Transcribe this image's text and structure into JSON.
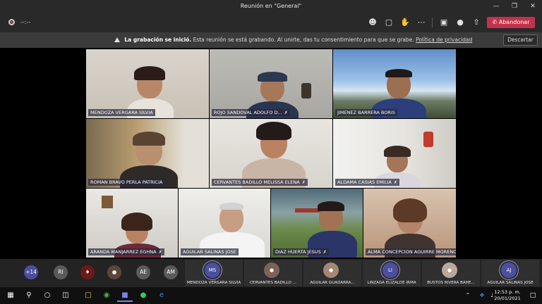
{
  "window": {
    "title": "Reunión en \"General\""
  },
  "toolbar": {
    "timer": "--:--",
    "leave_label": "Abandonar"
  },
  "banner": {
    "title": "La grabación se inició.",
    "message": "Esta reunión se está grabando. Al unirte, das tu consentimiento para que se grabe.",
    "link": "Política de privacidad",
    "dismiss_label": "Descartar"
  },
  "participants": [
    {
      "name": "MENDOZA VERGARA SILVIA"
    },
    {
      "name": "ROJO SANDOVAL ADOLFO D..."
    },
    {
      "name": "JIMENEZ BARRERA BORIS"
    },
    {
      "name": "ROMAN BRAVO PERLA PATRICIA"
    },
    {
      "name": "CERVANTES BADILLO MELISSA ELENA"
    },
    {
      "name": "ALDAMA CASIAS EMILIA"
    },
    {
      "name": "ARANDA MANJARREZ EGHNA"
    },
    {
      "name": "AGUILAR SALINAS JOSE"
    },
    {
      "name": "DIAZ HUERTA JESUS"
    },
    {
      "name": "ALMA CONCEPCION AGUIRRE MORENO"
    }
  ],
  "roster": {
    "overflow_count": "+14",
    "avatars": [
      "RI",
      "AE",
      "AM"
    ],
    "tiles": [
      {
        "initials": "MS",
        "name": "MENDOZA VERGARA SILVIA"
      },
      {
        "initials": "",
        "name": "CERVANTES BADILLO ..."
      },
      {
        "initials": "",
        "name": "AGUILAR GUADARRA..."
      },
      {
        "initials": "LI",
        "name": "LINZAGA ELIZALDE IRMA"
      },
      {
        "initials": "",
        "name": "BUSTOS RIVERA BAHE..."
      },
      {
        "initials": "AJ",
        "name": "AGUILAR SALINAS JOSE"
      }
    ]
  },
  "taskbar": {
    "time": "12:53 p. m.",
    "date": "20/01/2021"
  },
  "colors": {
    "leave": "#c4314b",
    "accent": "#4c4f9e"
  }
}
